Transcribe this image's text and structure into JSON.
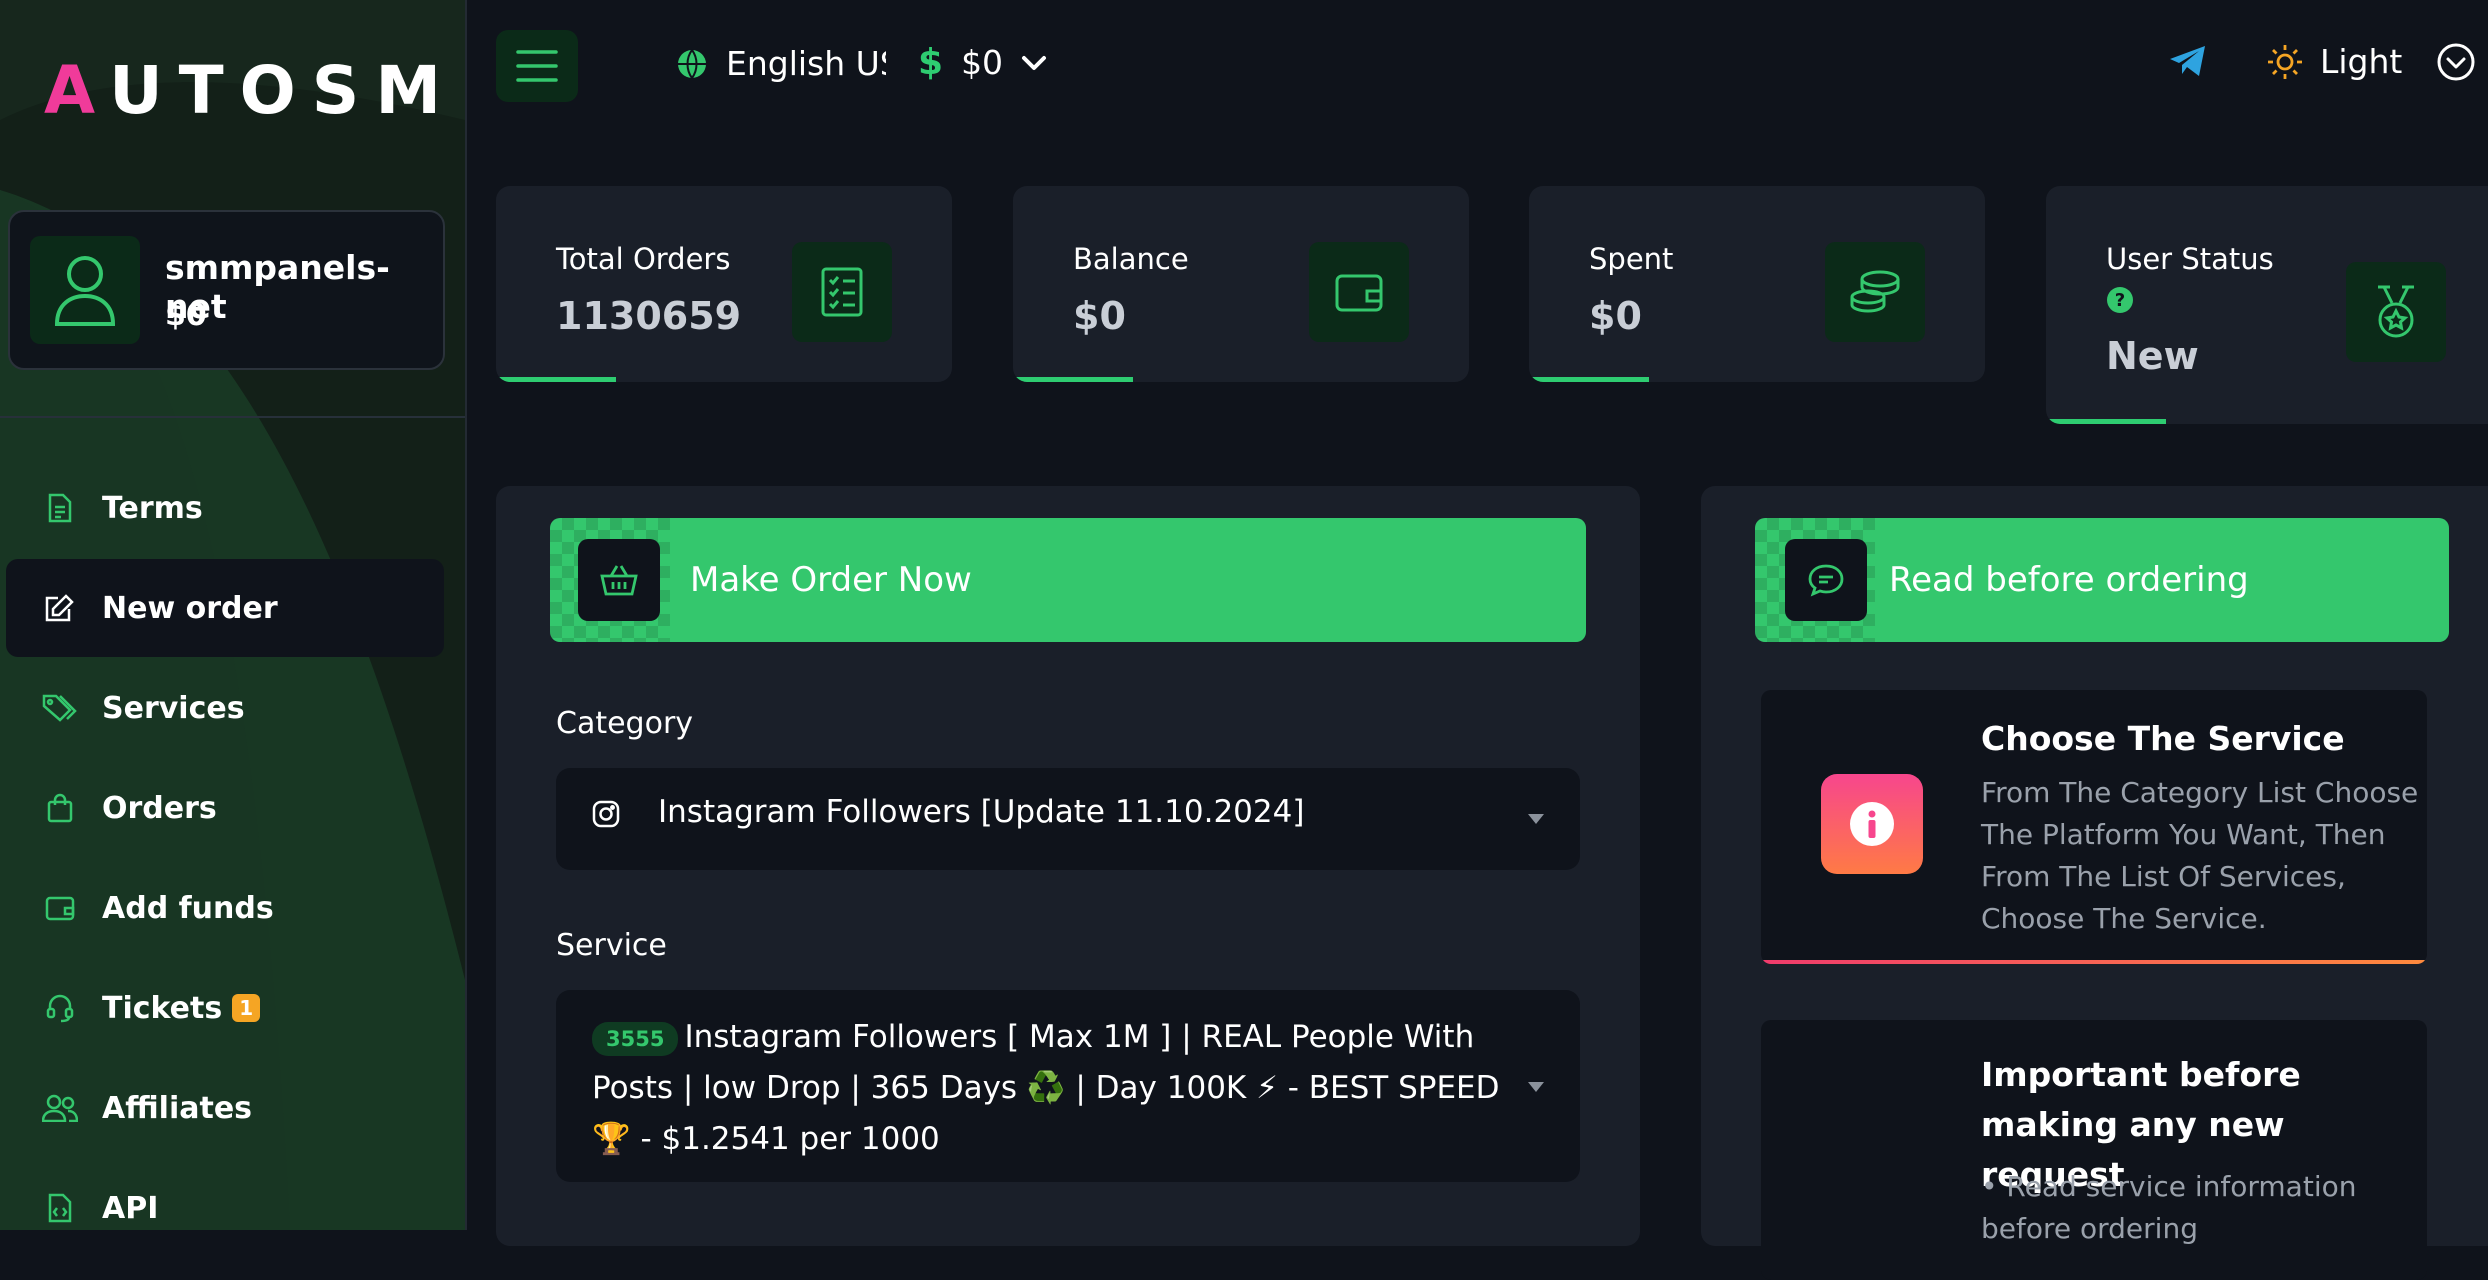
{
  "brand": {
    "logo_accent": "A",
    "logo_rest": "UTOSM"
  },
  "profile": {
    "username": "smmpanels-net",
    "balance": "$0"
  },
  "sidebar": {
    "items": [
      {
        "label": "Terms",
        "icon": "file-text-icon"
      },
      {
        "label": "New order",
        "icon": "edit-icon",
        "active": true
      },
      {
        "label": "Services",
        "icon": "tags-icon"
      },
      {
        "label": "Orders",
        "icon": "shopping-bag-icon"
      },
      {
        "label": "Add funds",
        "icon": "wallet-icon"
      },
      {
        "label": "Tickets",
        "icon": "headset-icon",
        "badge": "1"
      },
      {
        "label": "Affiliates",
        "icon": "users-icon"
      },
      {
        "label": "API",
        "icon": "code-file-icon"
      }
    ]
  },
  "topbar": {
    "language": "English US",
    "currency": "$0",
    "theme_label": "Light"
  },
  "stats": {
    "total_orders": {
      "label": "Total Orders",
      "value": "1130659"
    },
    "balance": {
      "label": "Balance",
      "value": "$0"
    },
    "spent": {
      "label": "Spent",
      "value": "$0"
    },
    "user_status": {
      "label": "User Status",
      "value": "New"
    }
  },
  "order": {
    "banner": "Make Order Now",
    "category_label": "Category",
    "category_value": "Instagram Followers [Update 11.10.2024]",
    "service_label": "Service",
    "service_id": "3555",
    "service_value": "Instagram Followers [ Max 1M ] | REAL People With Posts | low Drop | 365 Days ♻️ | Day 100K ⚡ - BEST SPEED🏆 - $1.2541 per 1000"
  },
  "info": {
    "banner": "Read before ordering",
    "card1": {
      "title": "Choose The Service",
      "desc": "From The Category List Choose The Platform You Want, Then From The List Of Services, Choose The Service."
    },
    "card2": {
      "title": "Important before making any new request",
      "desc": "• Read service information before ordering"
    }
  },
  "colors": {
    "accent": "#34c76d",
    "brand_pink": "#f03b9a",
    "badge": "#f5a524"
  }
}
